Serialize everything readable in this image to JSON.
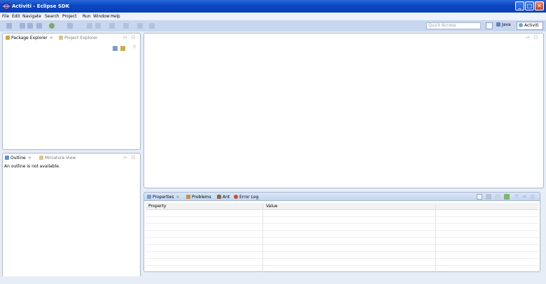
{
  "window": {
    "title": "Activiti - Eclipse SDK",
    "controls": {
      "minimize": "_",
      "maximize": "□",
      "close": "✕"
    }
  },
  "menu": [
    "File",
    "Edit",
    "Navigate",
    "Search",
    "Project",
    "Run",
    "Window",
    "Help"
  ],
  "toolbar": {
    "quick_access_placeholder": "Quick Access",
    "perspectives": {
      "java": "Java",
      "activiti": "Activiti"
    }
  },
  "package_explorer": {
    "tabs": [
      "Package Explorer",
      "Project Explorer"
    ],
    "close_glyph": "✕"
  },
  "outline": {
    "tabs": [
      "Outline",
      "Miniature View"
    ],
    "message": "An outline is not available.",
    "close_glyph": "✕"
  },
  "properties": {
    "tabs": [
      "Properties",
      "Problems",
      "Ant",
      "Error Log"
    ],
    "close_glyph": "✕",
    "columns": [
      "Property",
      "Value",
      ""
    ]
  },
  "colors": {
    "titlebar": "#0a45c2",
    "toolbar": "#c8d6ee",
    "workbench": "#e7edf6",
    "panel_border": "#a9b7cf"
  }
}
